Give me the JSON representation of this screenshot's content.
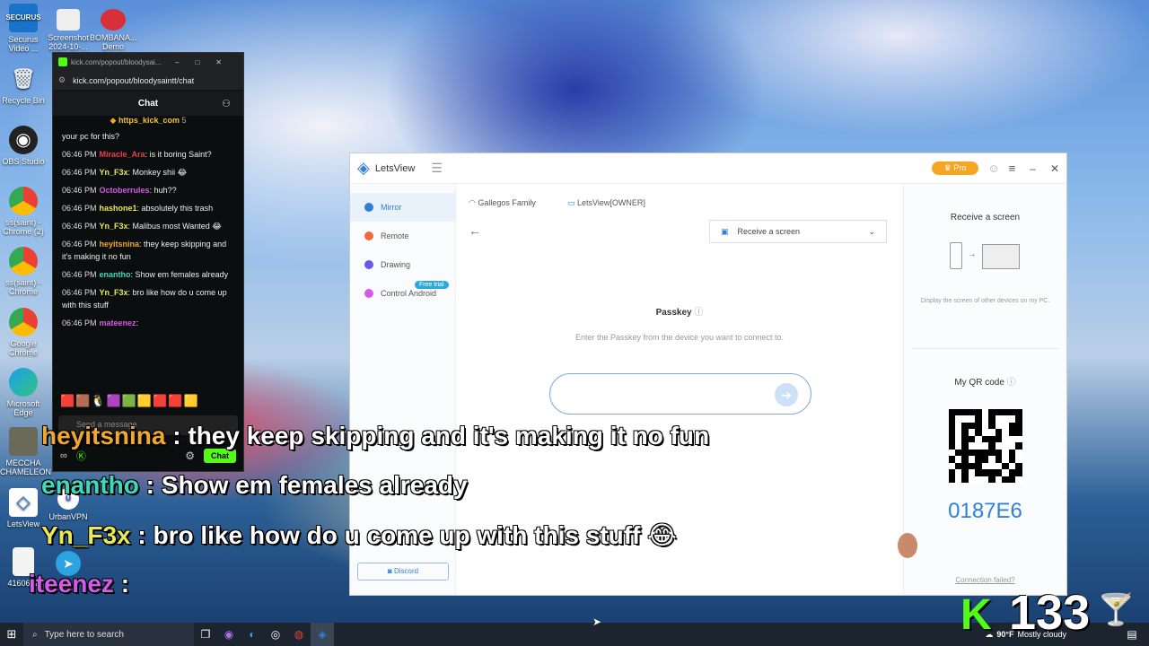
{
  "desktop": {
    "icons": [
      {
        "label": "Securus Video ...",
        "glyph": "SECURUS"
      },
      {
        "label": "Screenshot 2024-10-...",
        "glyph": ""
      },
      {
        "label": "BOMBANA... Demo",
        "glyph": ""
      },
      {
        "label": "Recycle Bin",
        "glyph": "🗑"
      },
      {
        "label": "OBS Studio",
        "glyph": "◉"
      },
      {
        "label": "ss(saint) - Chrome (2)",
        "glyph": ""
      },
      {
        "label": "ss(saint) - Chrome",
        "glyph": ""
      },
      {
        "label": "Google Chrome",
        "glyph": ""
      },
      {
        "label": "Microsoft Edge",
        "glyph": ""
      },
      {
        "label": "MECCHA CHAMELEON",
        "glyph": ""
      },
      {
        "label": "LetsView",
        "glyph": "◇"
      },
      {
        "label": "UrbanVPN",
        "glyph": "U"
      },
      {
        "label": "4160642",
        "glyph": ""
      }
    ]
  },
  "kick": {
    "tab_title": "kick.com/popout/bloodysai...",
    "url": "kick.com/popout/bloodysaintt/chat",
    "chat_title": "Chat",
    "pinned_user": "https_kick_com",
    "pinned_count": "5",
    "top_fragment": "your pc for this?",
    "messages": [
      {
        "time": "06:46 PM",
        "user": "Miracle_Ara",
        "color": "#e8404a",
        "text": ": is it boring Saint?"
      },
      {
        "time": "06:46 PM",
        "user": "Yn_F3x",
        "color": "#e8e85a",
        "text": ": Monkey shii 😂"
      },
      {
        "time": "06:46 PM",
        "user": "Octoberrules",
        "color": "#d65ae8",
        "text": ": huh??"
      },
      {
        "time": "06:46 PM",
        "user": "hashone1",
        "color": "#e8e85a",
        "text": ": absolutely this trash"
      },
      {
        "time": "06:46 PM",
        "user": "Yn_F3x",
        "color": "#e8e85a",
        "text": ": Malibus most Wanted 😂"
      },
      {
        "time": "06:46 PM",
        "user": "heyitsnina",
        "color": "#f0a830",
        "text": ": they keep skipping and it's making it no fun"
      },
      {
        "time": "06:46 PM",
        "user": "enantho",
        "color": "#40d8b8",
        "text": ": Show em females already"
      },
      {
        "time": "06:46 PM",
        "user": "Yn_F3x",
        "color": "#e8e85a",
        "text": ": bro like how do u come up with this stuff"
      },
      {
        "time": "06:46 PM",
        "user": "mateenez",
        "color": "#d65ae8",
        "text": ":"
      }
    ],
    "input_placeholder": "Send a message",
    "chat_button": "Chat"
  },
  "letsview": {
    "app_name": "LetsView",
    "pro_label": "Pro",
    "sidebar": [
      {
        "label": "Mirror",
        "color": "#2f80d6",
        "active": true
      },
      {
        "label": "Remote",
        "color": "#f06a3a",
        "active": false
      },
      {
        "label": "Drawing",
        "color": "#6a5ae8",
        "active": false
      },
      {
        "label": "Control Android",
        "color": "#d65ae8",
        "active": false
      }
    ],
    "free_trial": "Free trial",
    "discord": "Discord",
    "wifi_name": "Gallegos Family",
    "device_name": "LetsView[OWNER]",
    "receive_dropdown": "Receive a screen",
    "passkey_title": "Passkey",
    "passkey_hint": "Enter the Passkey from the device you want to connect to.",
    "right": {
      "receive_title": "Receive a screen",
      "receive_desc": "Display the screen of other devices on my PC.",
      "qr_title": "My QR code",
      "code": "0187E6",
      "connection_failed": "Connection failed?"
    }
  },
  "captions": [
    {
      "user": "heyitsnina",
      "color": "#f0a830",
      "text": " : they keep skipping and it's making it no fun"
    },
    {
      "user": "enantho",
      "color": "#40d8b8",
      "text": " : Show em females already"
    },
    {
      "user": "Yn_F3x",
      "color": "#e8e85a",
      "text": " : bro like how do u come up with this stuff 😂"
    },
    {
      "user": "iteenez",
      "color": "#d65ae8",
      "text": " :"
    }
  ],
  "taskbar": {
    "search_placeholder": "Type here to search",
    "weather_temp": "90°F",
    "weather_desc": "Mostly cloudy",
    "overlay_count": "133"
  }
}
